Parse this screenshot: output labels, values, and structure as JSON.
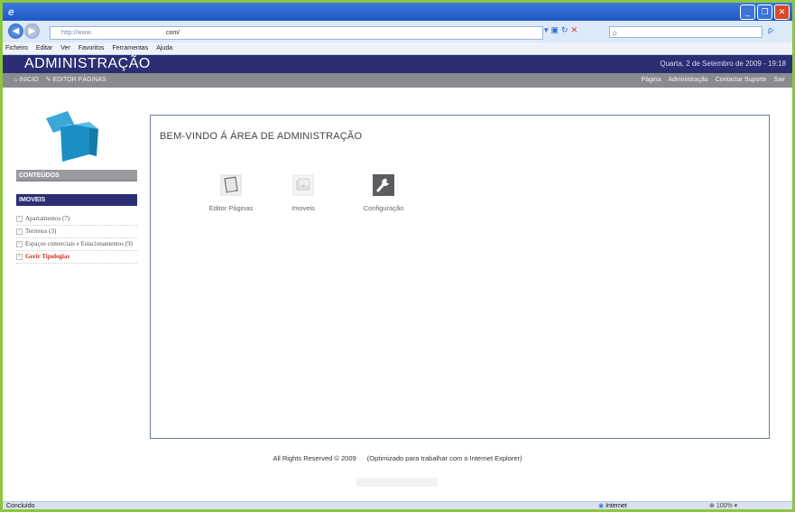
{
  "browser": {
    "address_prefix": "http://www.",
    "address_suffix": "com/",
    "search_placeholder": "ρ",
    "menu": [
      "Ficheiro",
      "Editar",
      "Ver",
      "Favoritos",
      "Ferramentas",
      "Ajuda"
    ]
  },
  "header": {
    "title": "ADMINISTRAÇÃO",
    "date": "Quarta, 2 de Setembro de 2009 - 19:18"
  },
  "subnav": {
    "left": [
      "INICIO",
      "EDITOR PÁGINAS"
    ],
    "right": [
      "Página",
      "Administração",
      "Contactar Suporte",
      "Sair"
    ]
  },
  "sidebar": {
    "section1": "CONTEÚDOS",
    "section2": "IMOVEIS",
    "items": [
      {
        "label": "Apartamentos (7)",
        "red": false
      },
      {
        "label": "Terrenos (3)",
        "red": false
      },
      {
        "label": "Espaços comerciais e Estacionamentos (9)",
        "red": false
      },
      {
        "label": "Gerir Tipologias",
        "red": true
      }
    ]
  },
  "main": {
    "title": "BEM-VINDO Á ÁREA DE ADMINISTRAÇÃO",
    "tiles": [
      {
        "label": "Editor Páginas",
        "icon": "editor-pages-icon"
      },
      {
        "label": "Imoveis",
        "icon": "properties-icon"
      },
      {
        "label": "Configuração",
        "icon": "wrench-icon"
      }
    ]
  },
  "footer": {
    "left": "All Rights Reserved © 2009",
    "right": "(Optimizado para trabalhar com o Internet Explorer)"
  },
  "status": {
    "left": "Concluído",
    "zone": "Internet",
    "zoom": "100%"
  },
  "colors": {
    "admin_bar": "#2b2e72",
    "subnav": "#8a8b8f",
    "accent_red": "#cc3322",
    "outer_frame": "#8dc63f"
  }
}
